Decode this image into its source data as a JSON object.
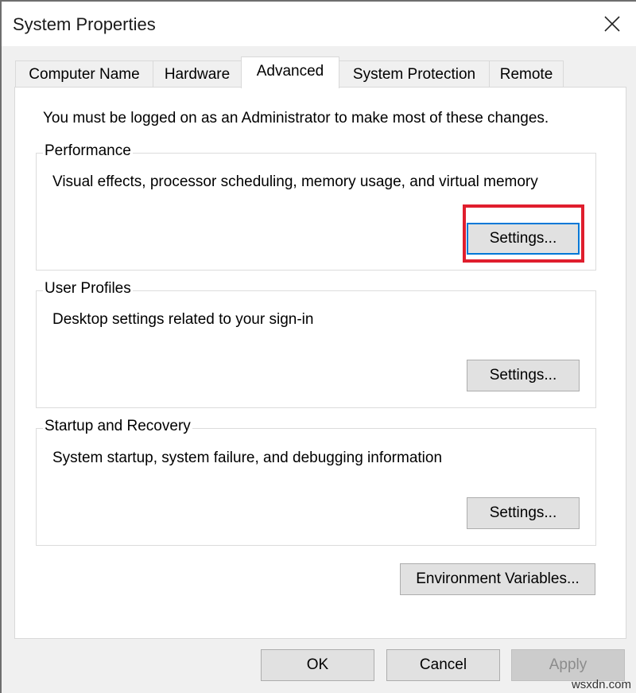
{
  "window": {
    "title": "System Properties",
    "close_icon": "close-icon"
  },
  "tabs": [
    {
      "label": "Computer Name",
      "active": false
    },
    {
      "label": "Hardware",
      "active": false
    },
    {
      "label": "Advanced",
      "active": true
    },
    {
      "label": "System Protection",
      "active": false
    },
    {
      "label": "Remote",
      "active": false
    }
  ],
  "advanced": {
    "admin_note": "You must be logged on as an Administrator to make most of these changes.",
    "groups": [
      {
        "label": "Performance",
        "description": "Visual effects, processor scheduling, memory usage, and virtual memory",
        "button": "Settings...",
        "highlighted": true
      },
      {
        "label": "User Profiles",
        "description": "Desktop settings related to your sign-in",
        "button": "Settings..."
      },
      {
        "label": "Startup and Recovery",
        "description": "System startup, system failure, and debugging information",
        "button": "Settings..."
      }
    ],
    "env_button": "Environment Variables..."
  },
  "footer": {
    "ok": "OK",
    "cancel": "Cancel",
    "apply": "Apply"
  },
  "colors": {
    "highlight": "#e01e2d",
    "focus": "#0078d7"
  },
  "watermark": "wsxdn.com"
}
